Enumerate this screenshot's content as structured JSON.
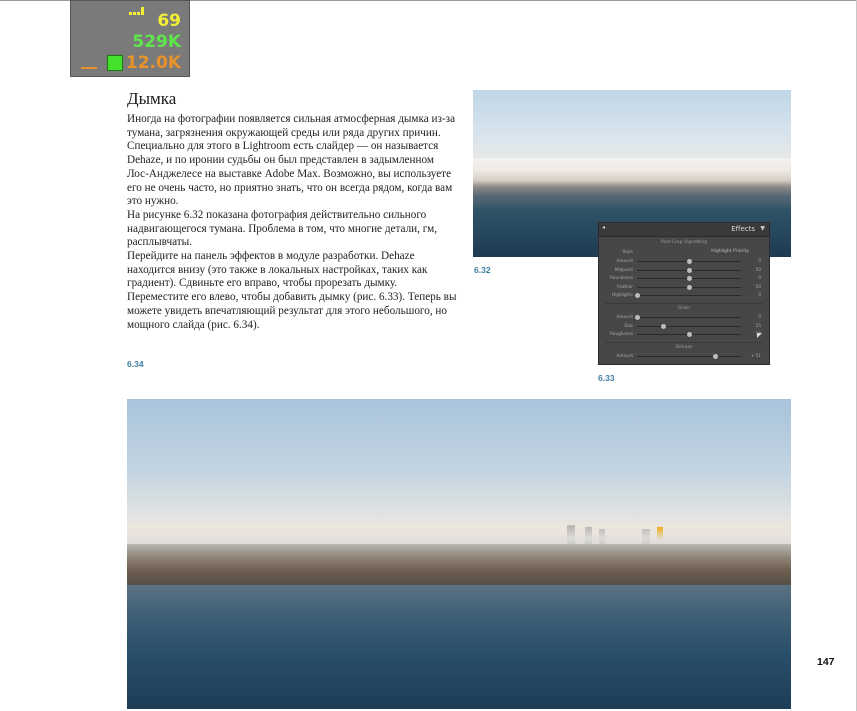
{
  "overlay": {
    "fps": "69",
    "memory": "529K",
    "gpu": "12.0K"
  },
  "heading": "Дымка",
  "paragraphs": [
    "Иногда на фотографии появляется сильная атмосферная дымка из-за тумана, загрязнения окружающей среды или ряда других причин. Специально для этого в Lightroom есть слайдер — он называется Dehaze, и по иронии судьбы он был представлен в задымленном Лос-Анджелесе на выставке Adobe Max. Возможно, вы используете его не очень часто, но приятно знать, что он всегда рядом, когда вам это нужно.",
    "На рисунке 6.32 показана фотография действительно сильного надвигающегося тумана. Проблема в том, что многие детали, гм, расплывчаты.",
    "Перейдите на панель эффектов в модуле разработки. Dehaze находится внизу (это также в локальных настройках, таких как градиент). Сдвиньте его вправо, чтобы прорезать дымку. Переместите его влево, чтобы добавить дымку (рис. 6.33). Теперь вы можете увидеть впечатляющий результат для этого небольшого, но мощного слайда (рис. 6.34)."
  ],
  "captions": {
    "fig632": "6.32",
    "fig633": "6.33",
    "fig634": "6.34"
  },
  "page_number": "147",
  "effects_panel": {
    "title": "Effects",
    "vignette_section": "Post-Crop Vignetting",
    "style_label": "Style",
    "style_value": "Highlight Priority",
    "vignette_sliders": [
      {
        "label": "Amount",
        "value": "0",
        "pos": 0.5
      },
      {
        "label": "Midpoint",
        "value": "50",
        "pos": 0.5
      },
      {
        "label": "Roundness",
        "value": "0",
        "pos": 0.5
      },
      {
        "label": "Feather",
        "value": "50",
        "pos": 0.5
      },
      {
        "label": "Highlights",
        "value": "0",
        "pos": 0.0
      }
    ],
    "grain_section": "Grain",
    "grain_sliders": [
      {
        "label": "Amount",
        "value": "0",
        "pos": 0.0
      },
      {
        "label": "Size",
        "value": "25",
        "pos": 0.25
      },
      {
        "label": "Roughness",
        "value": "50",
        "pos": 0.5
      }
    ],
    "dehaze_section": "Dehaze",
    "dehaze_slider": {
      "label": "Amount",
      "value": "+ 51",
      "pos": 0.75
    }
  }
}
